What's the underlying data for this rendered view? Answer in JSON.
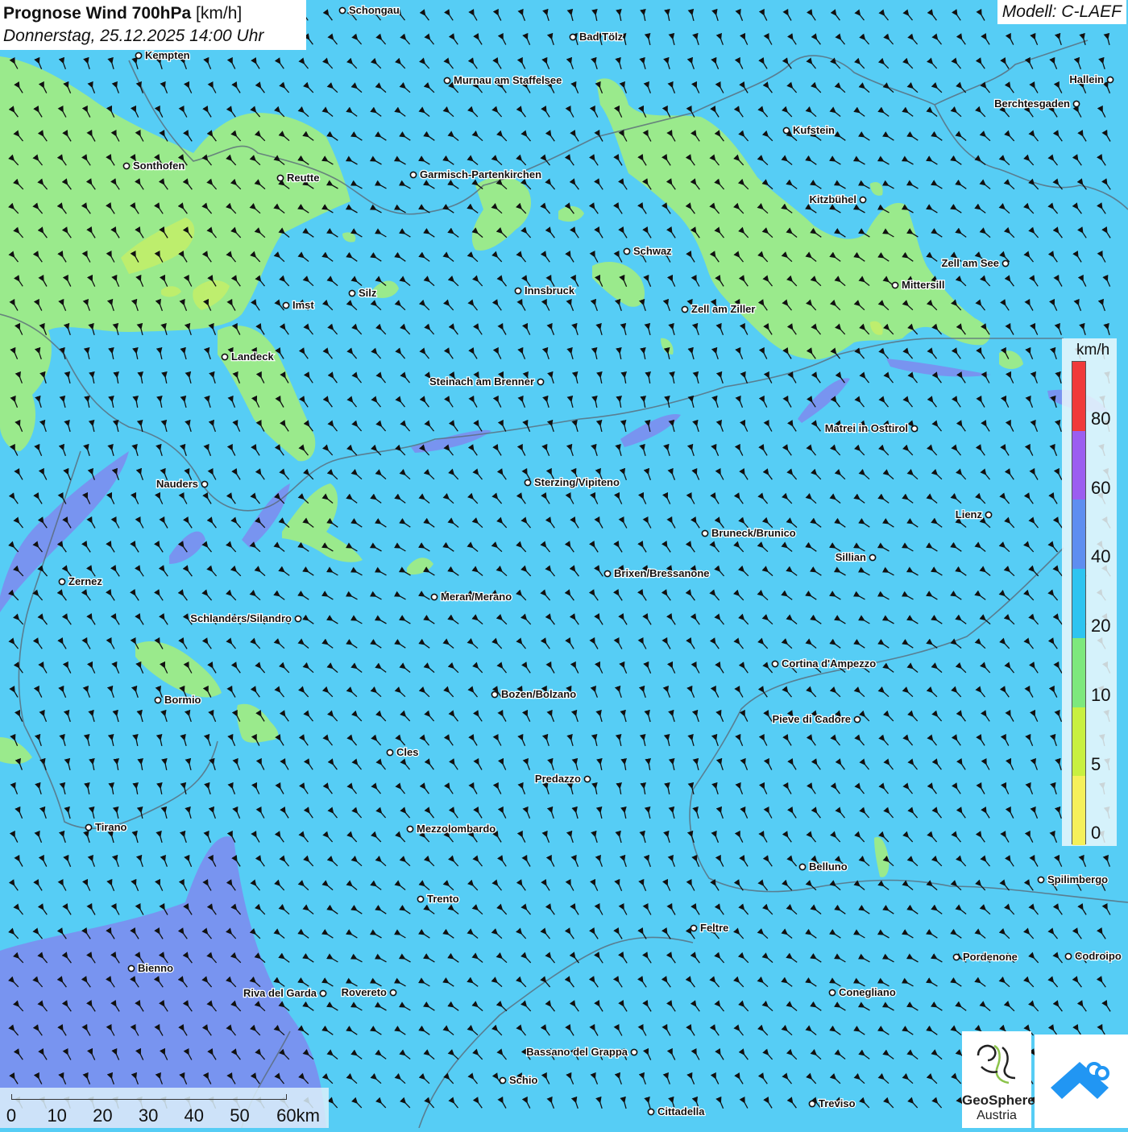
{
  "title": {
    "bold": "Prognose Wind 700hPa",
    "unit": "[km/h]",
    "datetime": "Donnerstag, 25.12.2025 14:00 Uhr"
  },
  "model": "Modell: C-LAEF",
  "legend": {
    "unit": "km/h",
    "labels": [
      "80",
      "60",
      "40",
      "20",
      "10",
      "5",
      "0"
    ],
    "colors": [
      "#f03a3a",
      "#9b5ef0",
      "#5e8ef0",
      "#2ec4f0",
      "#7de87d",
      "#c8f040",
      "#f5f05a"
    ]
  },
  "scalebar": {
    "labels": [
      "0",
      "10",
      "20",
      "30",
      "40",
      "50",
      "60km"
    ]
  },
  "logos": {
    "geosphere_line1": "GeoSphere",
    "geosphere_line2": "Austria"
  },
  "colors": {
    "background": "#56cdf5",
    "light_green": "#9aea8c",
    "purple": "#7c8ef0"
  },
  "cities": [
    {
      "name": "Schongau"
    },
    {
      "name": "Bad Tölz"
    },
    {
      "name": "Kempten"
    },
    {
      "name": "Murnau am Staffelsee"
    },
    {
      "name": "Hallein"
    },
    {
      "name": "Berchtesgaden"
    },
    {
      "name": "Kufstein"
    },
    {
      "name": "Sonthofen"
    },
    {
      "name": "Reutte"
    },
    {
      "name": "Garmisch-Partenkirchen"
    },
    {
      "name": "Kitzbühel"
    },
    {
      "name": "Schwaz"
    },
    {
      "name": "Zell am See"
    },
    {
      "name": "Silz"
    },
    {
      "name": "Innsbruck"
    },
    {
      "name": "Mittersill"
    },
    {
      "name": "Imst"
    },
    {
      "name": "Zell am Ziller"
    },
    {
      "name": "Landeck"
    },
    {
      "name": "Steinach am Brenner"
    },
    {
      "name": "Matrei in Osttirol"
    },
    {
      "name": "Nauders"
    },
    {
      "name": "Sterzing/Vipiteno"
    },
    {
      "name": "Lienz"
    },
    {
      "name": "Bruneck/Brunico"
    },
    {
      "name": "Sillian"
    },
    {
      "name": "Zernez"
    },
    {
      "name": "Brixen/Bressanone"
    },
    {
      "name": "Meran/Merano"
    },
    {
      "name": "Schlanders/Silandro"
    },
    {
      "name": "Cortina d'Ampezzo"
    },
    {
      "name": "Bozen/Bolzano"
    },
    {
      "name": "Bormio"
    },
    {
      "name": "Pieve di Cadore"
    },
    {
      "name": "Cles"
    },
    {
      "name": "Predazzo"
    },
    {
      "name": "Tirano"
    },
    {
      "name": "Mezzolombardo"
    },
    {
      "name": "Belluno"
    },
    {
      "name": "Spilimbergo"
    },
    {
      "name": "Trento"
    },
    {
      "name": "Feltre"
    },
    {
      "name": "Pordenone"
    },
    {
      "name": "Codroipo"
    },
    {
      "name": "Bienno"
    },
    {
      "name": "Riva del Garda"
    },
    {
      "name": "Rovereto"
    },
    {
      "name": "Conegliano"
    },
    {
      "name": "Bassano del Grappa"
    },
    {
      "name": "Schio"
    },
    {
      "name": "Treviso"
    },
    {
      "name": "Cittadella"
    }
  ]
}
